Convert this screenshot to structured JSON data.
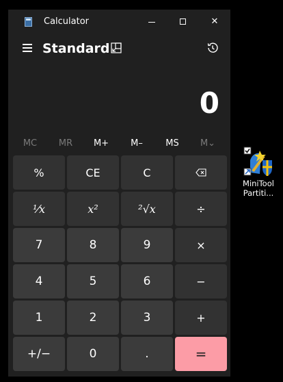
{
  "window": {
    "title": "Calculator",
    "minimize_label": "",
    "maximize_label": "",
    "close_label": "✕"
  },
  "header": {
    "mode": "Standard"
  },
  "display": {
    "value": "0"
  },
  "memory": [
    {
      "label": "MC",
      "enabled": false
    },
    {
      "label": "MR",
      "enabled": false
    },
    {
      "label": "M+",
      "enabled": true
    },
    {
      "label": "M–",
      "enabled": true
    },
    {
      "label": "MS",
      "enabled": true
    },
    {
      "label": "M⌄",
      "enabled": false
    }
  ],
  "keys": [
    {
      "label": "%",
      "kind": "fn"
    },
    {
      "label": "CE",
      "kind": "fn"
    },
    {
      "label": "C",
      "kind": "fn"
    },
    {
      "label": "⌫",
      "kind": "fn"
    },
    {
      "label": "¹⁄x",
      "kind": "fn"
    },
    {
      "label": "x²",
      "kind": "fn"
    },
    {
      "label": "²√x",
      "kind": "fn"
    },
    {
      "label": "÷",
      "kind": "fn"
    },
    {
      "label": "7",
      "kind": "num"
    },
    {
      "label": "8",
      "kind": "num"
    },
    {
      "label": "9",
      "kind": "num"
    },
    {
      "label": "×",
      "kind": "fn"
    },
    {
      "label": "4",
      "kind": "num"
    },
    {
      "label": "5",
      "kind": "num"
    },
    {
      "label": "6",
      "kind": "num"
    },
    {
      "label": "−",
      "kind": "fn"
    },
    {
      "label": "1",
      "kind": "num"
    },
    {
      "label": "2",
      "kind": "num"
    },
    {
      "label": "3",
      "kind": "num"
    },
    {
      "label": "+",
      "kind": "fn"
    },
    {
      "label": "+/−",
      "kind": "num"
    },
    {
      "label": "0",
      "kind": "num"
    },
    {
      "label": ".",
      "kind": "num"
    },
    {
      "label": "=",
      "kind": "eq"
    }
  ],
  "desktop": {
    "icon_label_line1": "MiniTool",
    "icon_label_line2": "Partiti..."
  },
  "colors": {
    "window_bg": "#202020",
    "key_fn": "#323232",
    "key_num": "#3b3b3b",
    "accent_equals": "#fc9ca6"
  }
}
